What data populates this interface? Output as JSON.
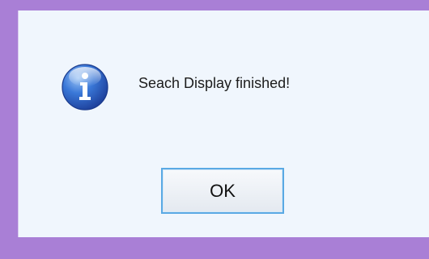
{
  "dialog": {
    "message": "Seach Display finished!",
    "ok_label": "OK"
  },
  "icons": {
    "info": "info-icon"
  },
  "colors": {
    "frame": "#a97fd6",
    "dialog_bg": "#f0f6fd",
    "button_border": "#5aa9e4",
    "icon_blue": "#2a5fbf"
  }
}
